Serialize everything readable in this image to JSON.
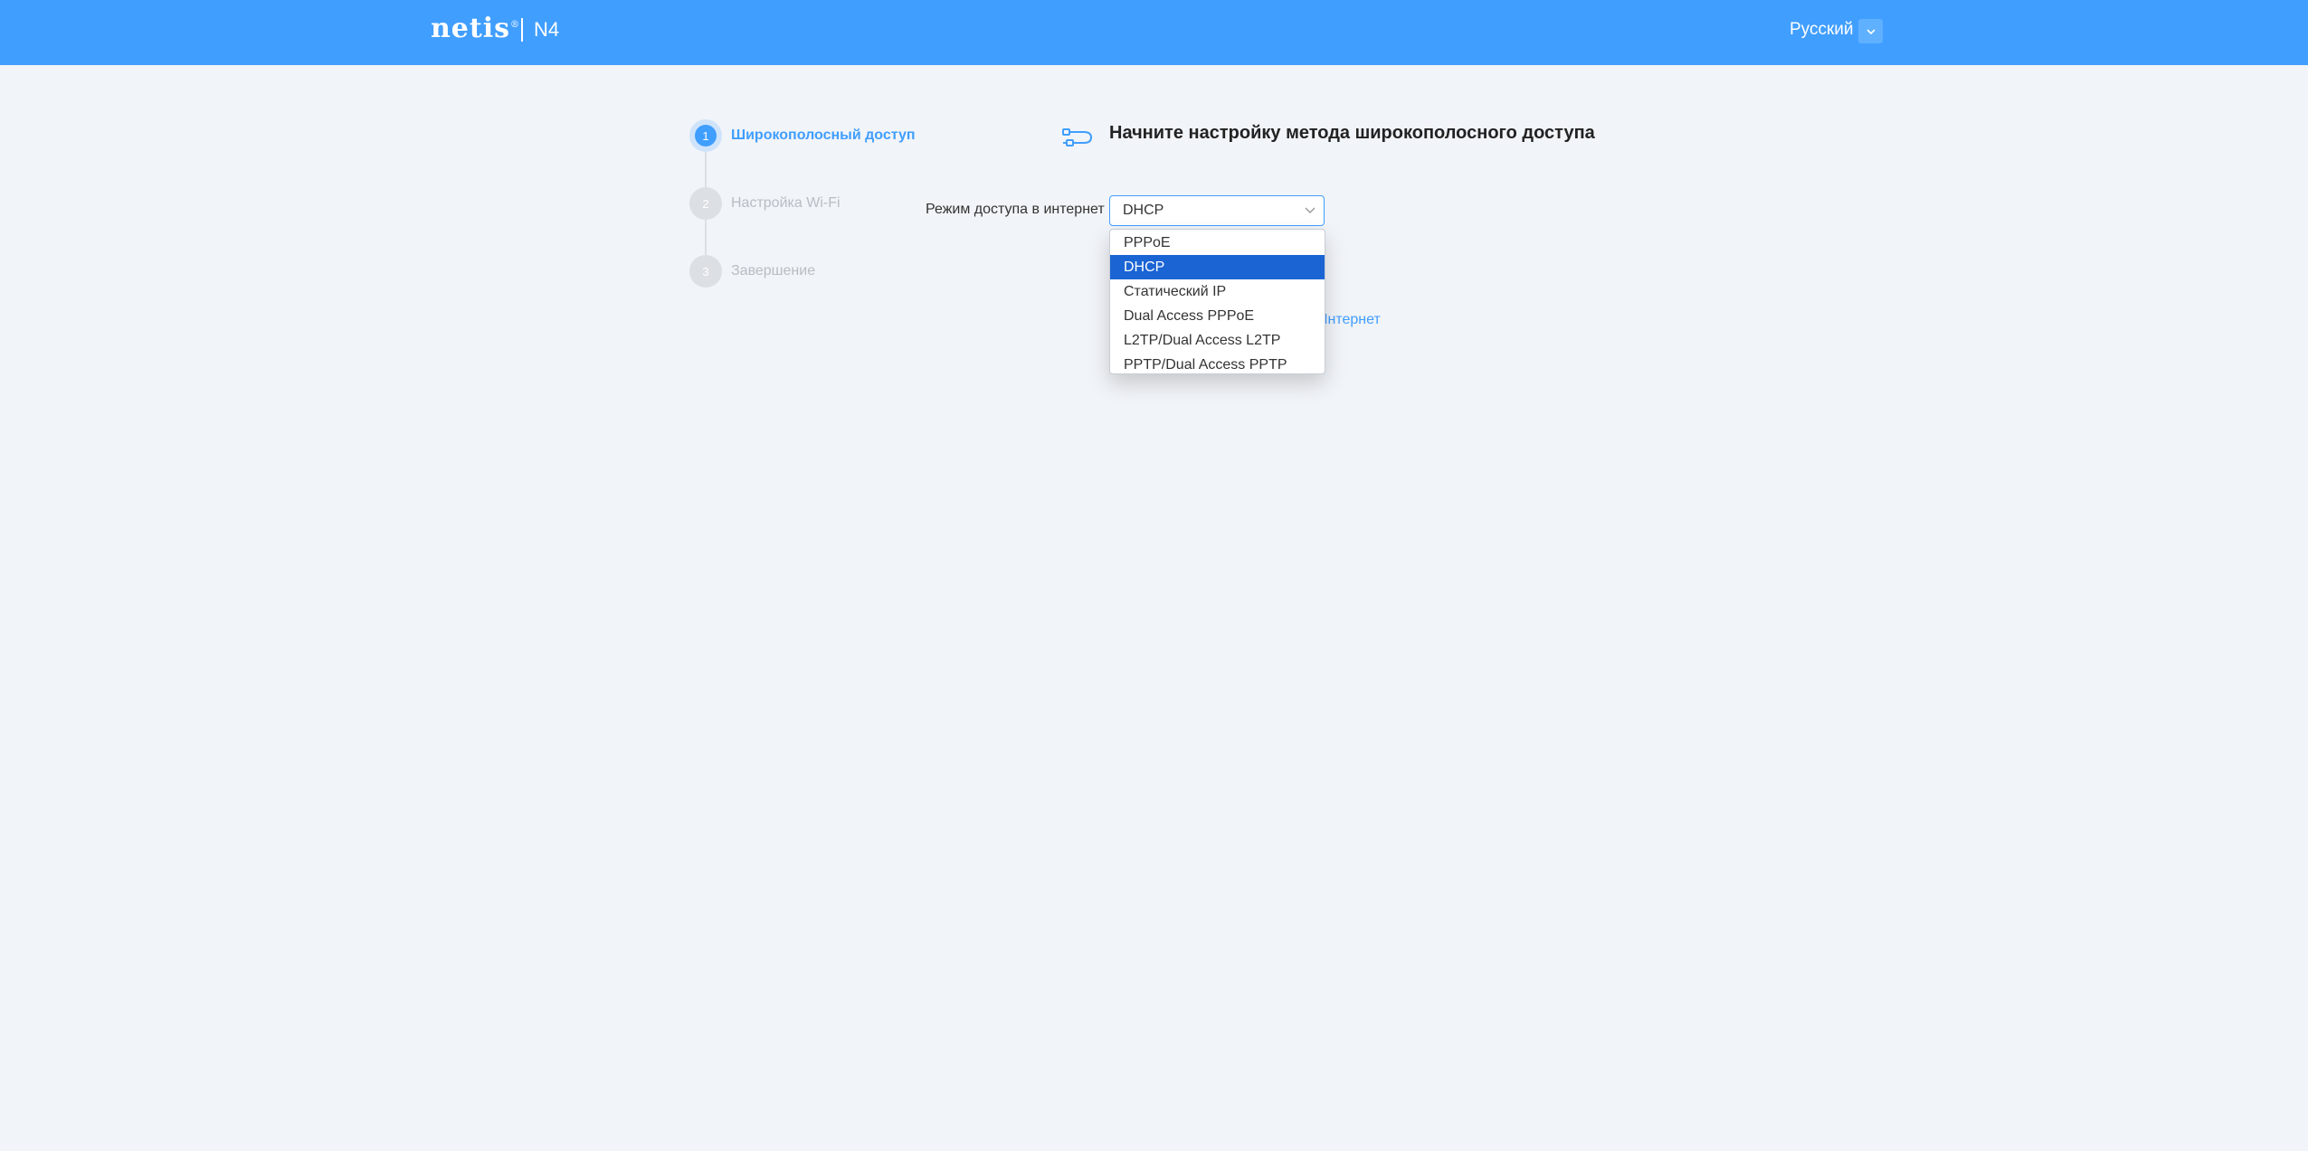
{
  "header": {
    "brand": "netis",
    "brand_mark": "®",
    "model": "N4",
    "language": "Русский"
  },
  "steps": [
    {
      "number": "1",
      "label": "Широкополосный доступ",
      "state": "active"
    },
    {
      "number": "2",
      "label": "Настройка Wi-Fi",
      "state": "inactive"
    },
    {
      "number": "3",
      "label": "Завершение",
      "state": "inactive"
    }
  ],
  "main": {
    "title": "Начните настройку метода широкополосного доступа",
    "icon": "ethernet-cable-icon",
    "access_mode_label": "Режим доступа в интернет",
    "access_mode_value": "DHCP",
    "partial_link_text": "Интернет"
  },
  "dropdown": {
    "options": [
      "PPPoE",
      "DHCP",
      "Статический IP",
      "Dual Access PPPoE",
      "L2TP/Dual Access L2TP",
      "PPTP/Dual Access PPTP"
    ],
    "selected": "DHCP"
  },
  "colors": {
    "header": "#409eff",
    "background": "#f1f4f8",
    "selected_option": "#1a64d4",
    "accent": "#409eff"
  }
}
